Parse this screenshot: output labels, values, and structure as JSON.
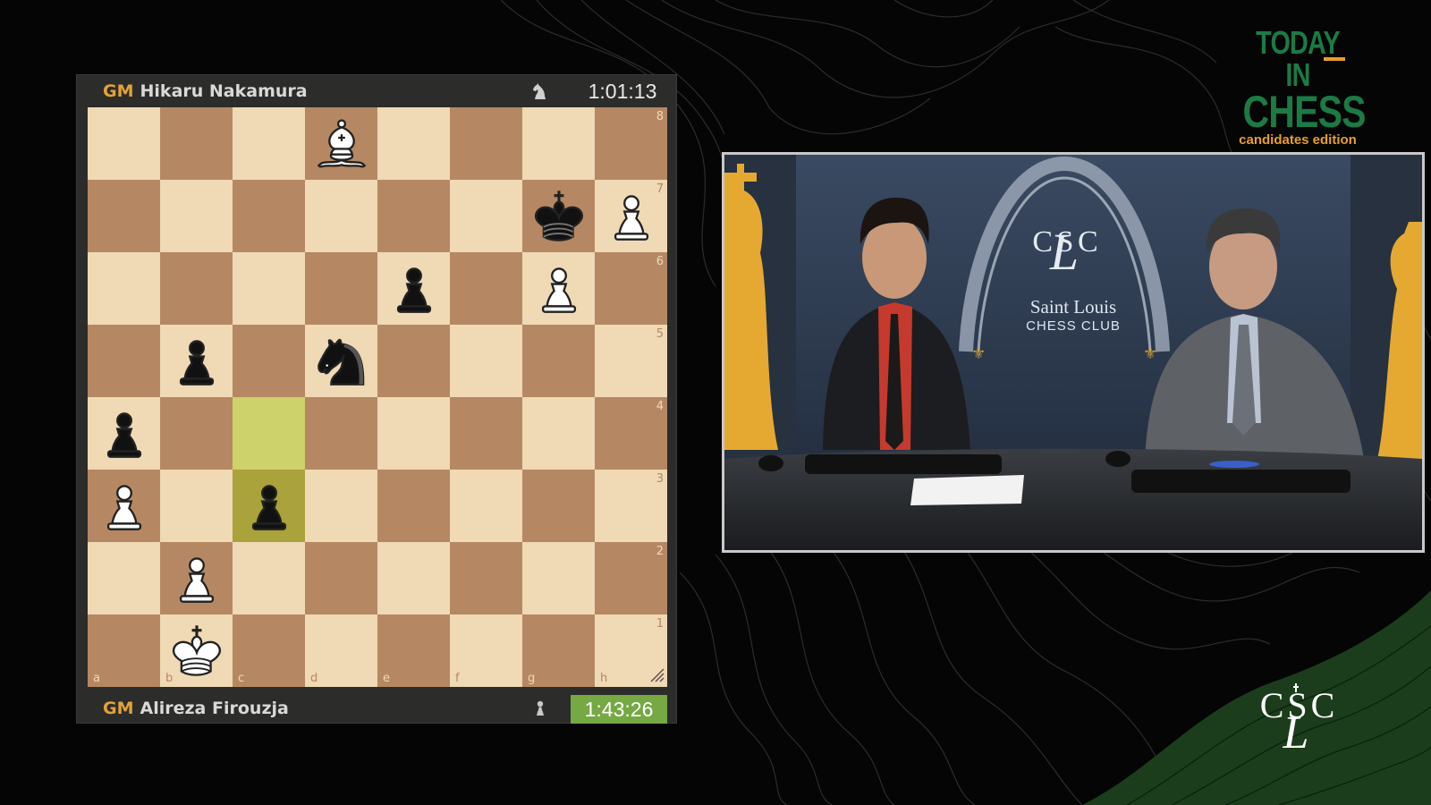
{
  "board_panel": {
    "top_player": {
      "title": "GM",
      "name": "Hikaru Nakamura",
      "clock": "1:01:13"
    },
    "bottom_player": {
      "title": "GM",
      "name": "Alireza Firouzja",
      "clock": "1:43:26"
    },
    "files": [
      "a",
      "b",
      "c",
      "d",
      "e",
      "f",
      "g",
      "h"
    ],
    "ranks": [
      "8",
      "7",
      "6",
      "5",
      "4",
      "3",
      "2",
      "1"
    ],
    "pieces": [
      {
        "square": "d8",
        "piece": "white-bishop"
      },
      {
        "square": "g7",
        "piece": "black-king"
      },
      {
        "square": "h7",
        "piece": "white-pawn"
      },
      {
        "square": "e6",
        "piece": "black-pawn"
      },
      {
        "square": "g6",
        "piece": "white-pawn"
      },
      {
        "square": "b5",
        "piece": "black-pawn"
      },
      {
        "square": "d5",
        "piece": "black-knight"
      },
      {
        "square": "a4",
        "piece": "black-pawn"
      },
      {
        "square": "a3",
        "piece": "white-pawn"
      },
      {
        "square": "c3",
        "piece": "black-pawn"
      },
      {
        "square": "b2",
        "piece": "white-pawn"
      },
      {
        "square": "b1",
        "piece": "white-king"
      }
    ],
    "last_move": [
      "c4",
      "c3"
    ],
    "colors": {
      "light": "#f0d9b5",
      "dark": "#b58863",
      "active_clock": "#76a844",
      "title_tag": "#e0a23b"
    }
  },
  "video": {
    "club_name": "Saint Louis",
    "club_sub": "CHESS CLUB",
    "club_monogram": "CSLC"
  },
  "brand": {
    "line1": "TODAY IN",
    "line2": "CHESS",
    "line3": "candidates edition",
    "logo_text": "CSLC",
    "colors": {
      "green": "#1c7a45",
      "orange": "#e8a02a"
    }
  }
}
